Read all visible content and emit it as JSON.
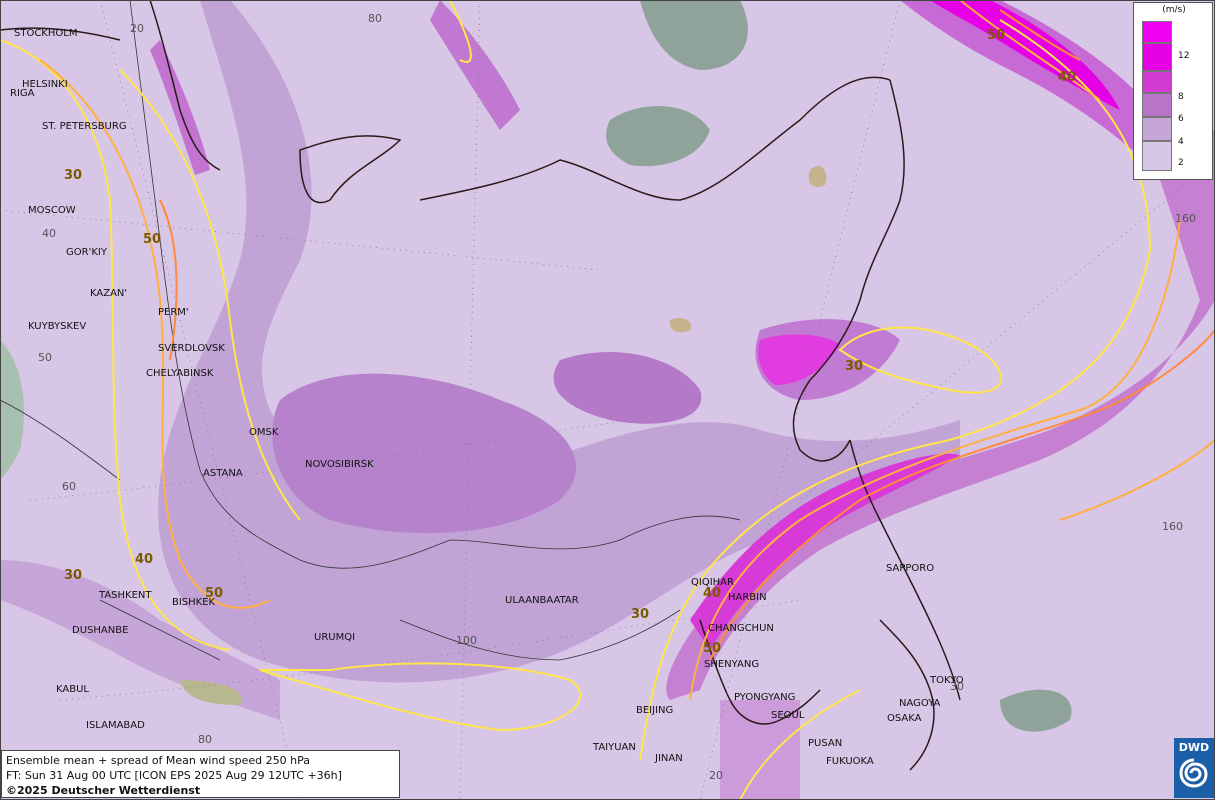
{
  "legend": {
    "unit": "(m/s)",
    "items": [
      {
        "label": "12",
        "color": "#e600e6"
      },
      {
        "label": "8",
        "color": "#d23cd2"
      },
      {
        "label": "6",
        "color": "#b874c8"
      },
      {
        "label": "4",
        "color": "#c6a6d8"
      },
      {
        "label": "2",
        "color": "#d8c6e6"
      }
    ],
    "top_color": "#f000f0"
  },
  "info": {
    "line1": "Ensemble mean + spread of Mean wind speed 250 hPa",
    "line2": "FT: Sun 31 Aug 00 UTC [ICON EPS 2025 Aug 29 12UTC +36h]",
    "line3": "©2025 Deutscher Wetterdienst"
  },
  "logo": {
    "text": "DWD"
  },
  "cities": [
    {
      "name": "STOCKHOLM"
    },
    {
      "name": "HELSINKI"
    },
    {
      "name": "RIGA"
    },
    {
      "name": "ST. PETERSBURG"
    },
    {
      "name": "MOSCOW"
    },
    {
      "name": "GOR'KIY"
    },
    {
      "name": "KAZAN'"
    },
    {
      "name": "KUYBYSKEV"
    },
    {
      "name": "PERM'"
    },
    {
      "name": "SVERDLOVSK"
    },
    {
      "name": "CHELYABINSK"
    },
    {
      "name": "OMSK"
    },
    {
      "name": "ASTANA"
    },
    {
      "name": "NOVOSIBIRSK"
    },
    {
      "name": "TASHKENT"
    },
    {
      "name": "BISHKEK"
    },
    {
      "name": "DUSHANBE"
    },
    {
      "name": "URUMQI"
    },
    {
      "name": "ULAANBAATAR"
    },
    {
      "name": "KABUL"
    },
    {
      "name": "ISLAMABAD"
    },
    {
      "name": "TAIYUAN"
    },
    {
      "name": "JINAN"
    },
    {
      "name": "BEIJING"
    },
    {
      "name": "QIQIHAR"
    },
    {
      "name": "HARBIN"
    },
    {
      "name": "CHANGCHUN"
    },
    {
      "name": "SHENYANG"
    },
    {
      "name": "PYONGYANG"
    },
    {
      "name": "SEOUL"
    },
    {
      "name": "PUSAN"
    },
    {
      "name": "FUKUOKA"
    },
    {
      "name": "OSAKA"
    },
    {
      "name": "NAGOYA"
    },
    {
      "name": "TOKYO"
    },
    {
      "name": "SAPPORO"
    }
  ],
  "grid_labels": [
    {
      "text": "20"
    },
    {
      "text": "80"
    },
    {
      "text": "40"
    },
    {
      "text": "50"
    },
    {
      "text": "60"
    },
    {
      "text": "100"
    },
    {
      "text": "80"
    },
    {
      "text": "160"
    },
    {
      "text": "160"
    },
    {
      "text": "20"
    },
    {
      "text": "30"
    }
  ],
  "contour_labels": [
    {
      "text": "30"
    },
    {
      "text": "50"
    },
    {
      "text": "40"
    },
    {
      "text": "30"
    },
    {
      "text": "50"
    },
    {
      "text": "30"
    },
    {
      "text": "40"
    },
    {
      "text": "50"
    },
    {
      "text": "30"
    },
    {
      "text": "40"
    },
    {
      "text": "50"
    }
  ]
}
